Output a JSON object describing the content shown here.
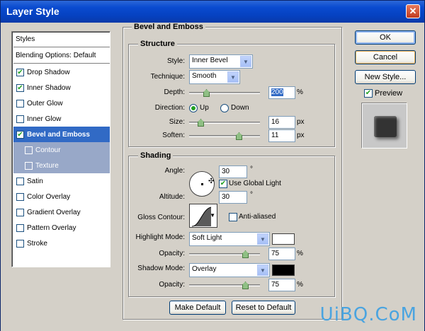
{
  "window": {
    "title": "Layer Style",
    "close_icon": "✕"
  },
  "styles_list": {
    "header": "Styles",
    "blending": "Blending Options: Default",
    "items": [
      {
        "label": "Drop Shadow",
        "checked": true
      },
      {
        "label": "Inner Shadow",
        "checked": true
      },
      {
        "label": "Outer Glow",
        "checked": false
      },
      {
        "label": "Inner Glow",
        "checked": false
      },
      {
        "label": "Bevel and Emboss",
        "checked": true,
        "selected": true
      },
      {
        "label": "Contour",
        "checked": false,
        "sub": true
      },
      {
        "label": "Texture",
        "checked": false,
        "sub": true
      },
      {
        "label": "Satin",
        "checked": false
      },
      {
        "label": "Color Overlay",
        "checked": false
      },
      {
        "label": "Gradient Overlay",
        "checked": false
      },
      {
        "label": "Pattern Overlay",
        "checked": false
      },
      {
        "label": "Stroke",
        "checked": false
      }
    ]
  },
  "bevel": {
    "title": "Bevel and Emboss",
    "structure": {
      "title": "Structure",
      "style_label": "Style:",
      "style_value": "Inner Bevel",
      "technique_label": "Technique:",
      "technique_value": "Smooth",
      "depth_label": "Depth:",
      "depth_value": "200",
      "depth_unit": "%",
      "direction_label": "Direction:",
      "direction_up": "Up",
      "direction_down": "Down",
      "size_label": "Size:",
      "size_value": "16",
      "size_unit": "px",
      "soften_label": "Soften:",
      "soften_value": "11",
      "soften_unit": "px"
    },
    "shading": {
      "title": "Shading",
      "angle_label": "Angle:",
      "angle_value": "30",
      "angle_unit": "°",
      "global_light": "Use Global Light",
      "altitude_label": "Altitude:",
      "altitude_value": "30",
      "altitude_unit": "°",
      "gloss_label": "Gloss Contour:",
      "anti_aliased": "Anti-aliased",
      "highlight_label": "Highlight Mode:",
      "highlight_value": "Soft Light",
      "highlight_color": "#ffffff",
      "hl_opacity_label": "Opacity:",
      "hl_opacity_value": "75",
      "hl_opacity_unit": "%",
      "shadow_label": "Shadow Mode:",
      "shadow_value": "Overlay",
      "shadow_color": "#000000",
      "sh_opacity_label": "Opacity:",
      "sh_opacity_value": "75",
      "sh_opacity_unit": "%"
    },
    "make_default": "Make Default",
    "reset_default": "Reset to Default"
  },
  "buttons": {
    "ok": "OK",
    "cancel": "Cancel",
    "new_style": "New Style..."
  },
  "preview_label": "Preview",
  "watermark": "UiBQ.CoM"
}
